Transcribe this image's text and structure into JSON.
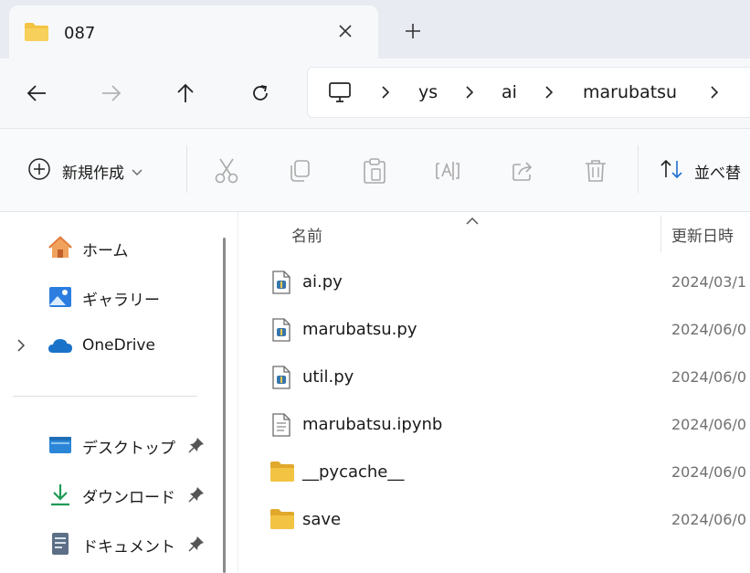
{
  "tab": {
    "title": "087",
    "close_icon": "close-icon",
    "new_tab_icon": "plus-icon"
  },
  "nav": {
    "back_icon": "arrow-left-icon",
    "forward_icon": "arrow-right-icon",
    "up_icon": "arrow-up-icon",
    "refresh_icon": "refresh-icon",
    "breadcrumbs": [
      "ys",
      "ai",
      "marubatsu"
    ]
  },
  "toolbar": {
    "new_label": "新規作成",
    "sort_label": "並べ替",
    "tools": [
      "cut-icon",
      "copy-icon",
      "paste-icon",
      "rename-icon",
      "share-icon",
      "delete-icon"
    ]
  },
  "sidebar": {
    "items": [
      {
        "label": "ホーム",
        "icon": "home-icon"
      },
      {
        "label": "ギャラリー",
        "icon": "gallery-icon"
      },
      {
        "label": "OneDrive",
        "icon": "cloud-icon"
      },
      {
        "label": "デスクトップ",
        "icon": "desktop-icon"
      },
      {
        "label": "ダウンロード",
        "icon": "download-icon"
      },
      {
        "label": "ドキュメント",
        "icon": "document-icon"
      }
    ]
  },
  "columns": {
    "name": "名前",
    "date": "更新日時"
  },
  "files": [
    {
      "name": "ai.py",
      "date": "2024/03/1",
      "type": "python"
    },
    {
      "name": "marubatsu.py",
      "date": "2024/06/0",
      "type": "python"
    },
    {
      "name": "util.py",
      "date": "2024/06/0",
      "type": "python"
    },
    {
      "name": "marubatsu.ipynb",
      "date": "2024/06/0",
      "type": "notebook"
    },
    {
      "name": "__pycache__",
      "date": "2024/06/0",
      "type": "folder"
    },
    {
      "name": "save",
      "date": "2024/06/0",
      "type": "folder"
    }
  ],
  "colors": {
    "folder": "#f3c343",
    "folder_dark": "#e0a92b",
    "onedrive": "#1a73c9",
    "accent": "#1f6fd1"
  }
}
